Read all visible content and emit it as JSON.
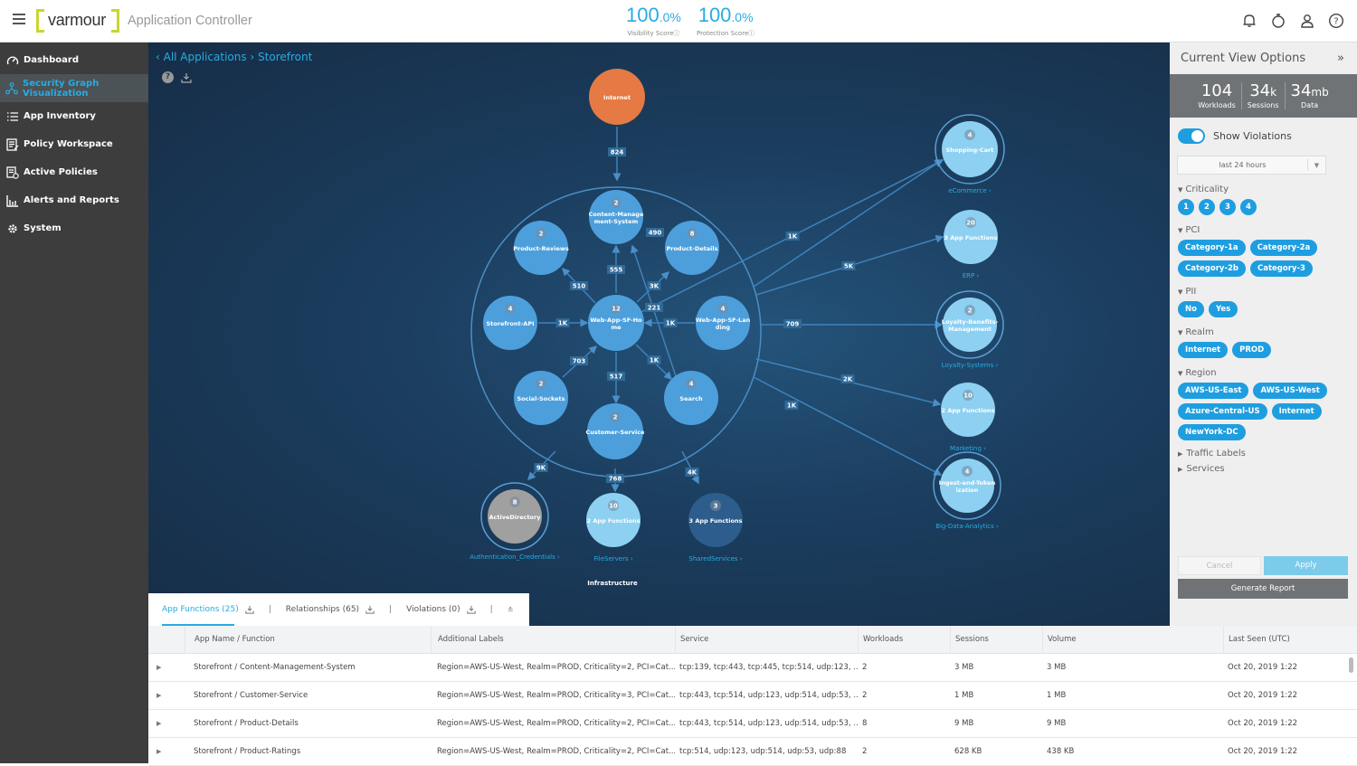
{
  "header": {
    "brand": "varmour",
    "app_title": "Application Controller",
    "visibility_score": {
      "value": "100",
      "decimal": ".0%",
      "label": "Visibility Scoreⓘ"
    },
    "protection_score": {
      "value": "100",
      "decimal": ".0%",
      "label": "Protection Scoreⓘ"
    },
    "icons": [
      "bell-icon",
      "timer-icon",
      "user-icon",
      "help-icon"
    ]
  },
  "sidebar": {
    "items": [
      {
        "label": "Dashboard",
        "icon": "gauge-icon",
        "active": false
      },
      {
        "label": "Security Graph Visualization",
        "icon": "graph-icon",
        "active": true
      },
      {
        "label": "App Inventory",
        "icon": "list-icon",
        "active": false
      },
      {
        "label": "Policy Workspace",
        "icon": "policy-edit-icon",
        "active": false
      },
      {
        "label": "Active Policies",
        "icon": "policy-check-icon",
        "active": false
      },
      {
        "label": "Alerts and Reports",
        "icon": "bar-chart-icon",
        "active": false
      },
      {
        "label": "System",
        "icon": "gear-icon",
        "active": false
      }
    ]
  },
  "graph": {
    "breadcrumb": "‹ All Applications › Storefront",
    "container_label": "Infrastructure",
    "nodes": [
      {
        "id": "internet",
        "label": [
          "Internet"
        ],
        "count": null,
        "color": "#e57a44"
      },
      {
        "id": "cms",
        "label": [
          "Content-Manage",
          "ment-System"
        ],
        "count": "2",
        "color": "#4d9fdc"
      },
      {
        "id": "reviews",
        "label": [
          "Product-Reviews"
        ],
        "count": "2",
        "color": "#4d9fdc"
      },
      {
        "id": "details",
        "label": [
          "Product-Details"
        ],
        "count": "8",
        "color": "#4d9fdc"
      },
      {
        "id": "api",
        "label": [
          "Storefront-API"
        ],
        "count": "4",
        "color": "#4d9fdc"
      },
      {
        "id": "home",
        "label": [
          "Web-App-SF-Ho",
          "me"
        ],
        "count": "12",
        "color": "#4d9fdc"
      },
      {
        "id": "landing",
        "label": [
          "Web-App-SF-Lan",
          "ding"
        ],
        "count": "4",
        "color": "#4d9fdc"
      },
      {
        "id": "social",
        "label": [
          "Social-Sockets"
        ],
        "count": "2",
        "color": "#4d9fdc"
      },
      {
        "id": "search",
        "label": [
          "Search"
        ],
        "count": "4",
        "color": "#4d9fdc"
      },
      {
        "id": "customer",
        "label": [
          "Customer-Service"
        ],
        "count": "2",
        "color": "#4d9fdc"
      },
      {
        "id": "ad",
        "label": [
          "ActiveDirectory"
        ],
        "count": "8",
        "color": "#a0a0a0",
        "group": "Authentication_Credentials ›"
      },
      {
        "id": "fileservers",
        "label": [
          "2 App Functions"
        ],
        "count": "10",
        "color": "#8dd0f2",
        "group": "FileServers ›"
      },
      {
        "id": "shared",
        "label": [
          "3 App Functions"
        ],
        "count": "3",
        "color": "#2c5d8c",
        "group": "SharedServices ›"
      },
      {
        "id": "cart",
        "label": [
          "Shopping-Cart"
        ],
        "count": "4",
        "color": "#8dd0f2",
        "group": "eCommerce ›"
      },
      {
        "id": "erp",
        "label": [
          "3 App Functions"
        ],
        "count": "20",
        "color": "#8dd0f2",
        "group": "ERP ›"
      },
      {
        "id": "loyalty",
        "label": [
          "Loyalty-Benefits-",
          "Management"
        ],
        "count": "2",
        "color": "#8dd0f2",
        "group": "Loyalty-Systems ›"
      },
      {
        "id": "marketing",
        "label": [
          "2 App Functions"
        ],
        "count": "10",
        "color": "#8dd0f2",
        "group": "Marketing ›"
      },
      {
        "id": "ingest",
        "label": [
          "Ingest-and-Token",
          "ization"
        ],
        "count": "4",
        "color": "#8dd0f2",
        "group": "Big-Data-Analytics ›"
      }
    ],
    "edges": [
      {
        "from": "internet",
        "to": "container",
        "label": "824"
      },
      {
        "from": "home",
        "to": "cms",
        "label": "555"
      },
      {
        "from": "home",
        "to": "reviews",
        "label": "510"
      },
      {
        "from": "home",
        "to": "details",
        "label": "3K"
      },
      {
        "from": "search",
        "to": "cms",
        "label": "490"
      },
      {
        "from": "api",
        "to": "home",
        "label": "1K"
      },
      {
        "from": "landing",
        "to": "home",
        "label": "1K"
      },
      {
        "from": "home",
        "to": "cart",
        "label": "221"
      },
      {
        "from": "social",
        "to": "home",
        "label": "703"
      },
      {
        "from": "home",
        "to": "customer",
        "label": "517"
      },
      {
        "from": "home",
        "to": "search",
        "label": "1K"
      },
      {
        "from": "container",
        "to": "ad",
        "label": "9K"
      },
      {
        "from": "container",
        "to": "fileservers",
        "label": "768"
      },
      {
        "from": "container",
        "to": "shared",
        "label": "4K"
      },
      {
        "from": "container",
        "to": "cart",
        "label": "1K"
      },
      {
        "from": "container",
        "to": "erp",
        "label": "5K"
      },
      {
        "from": "container",
        "to": "loyalty",
        "label": "709"
      },
      {
        "from": "container",
        "to": "marketing",
        "label": "2K"
      },
      {
        "from": "container",
        "to": "ingest",
        "label": "1K"
      }
    ]
  },
  "tabs": [
    {
      "label": "App Functions (25)",
      "active": true
    },
    {
      "label": "Relationships (65)",
      "active": false
    },
    {
      "label": "Violations (0)",
      "active": false
    }
  ],
  "panel": {
    "title": "Current View Options",
    "collapse_icon": "»",
    "stats": [
      {
        "value": "104",
        "unit": "",
        "label": "Workloads"
      },
      {
        "value": "34",
        "unit": "k",
        "label": "Sessions"
      },
      {
        "value": "34",
        "unit": "mb",
        "label": "Data"
      }
    ],
    "show_violations": {
      "label": "Show Violations",
      "on": true
    },
    "time_range": "last 24 hours",
    "filters": [
      {
        "title": "Criticality",
        "chips": [
          "1",
          "2",
          "3",
          "4"
        ],
        "round": true
      },
      {
        "title": "PCI",
        "chips": [
          "Category-1a",
          "Category-2a",
          "Category-2b",
          "Category-3"
        ]
      },
      {
        "title": "PII",
        "chips": [
          "No",
          "Yes"
        ]
      },
      {
        "title": "Realm",
        "chips": [
          "Internet",
          "PROD"
        ]
      },
      {
        "title": "Region",
        "chips": [
          "AWS-US-East",
          "AWS-US-West",
          "Azure-Central-US",
          "Internet",
          "NewYork-DC"
        ]
      }
    ],
    "collapsed_sections": [
      "Traffic Labels",
      "Services"
    ],
    "cancel_label": "Cancel",
    "apply_label": "Apply",
    "report_label": "Generate Report"
  },
  "table": {
    "columns": [
      "App Name / Function",
      "Additional Labels",
      "Service",
      "Workloads",
      "Sessions",
      "Volume",
      "Last Seen (UTC)"
    ],
    "rows": [
      [
        "Storefront / Content-Management-System",
        "Region=AWS-US-West, Realm=PROD, Criticality=2, PCI=Cat...",
        "tcp:139, tcp:443, tcp:445, tcp:514, udp:123, ...",
        "2",
        "3 MB",
        "3 MB",
        "Oct 20, 2019 1:22"
      ],
      [
        "Storefront / Customer-Service",
        "Region=AWS-US-West, Realm=PROD, Criticality=3, PCI=Cat...",
        "tcp:443, tcp:514, udp:123, udp:514, udp:53, ...",
        "2",
        "1 MB",
        "1 MB",
        "Oct 20, 2019 1:22"
      ],
      [
        "Storefront / Product-Details",
        "Region=AWS-US-West, Realm=PROD, Criticality=2, PCI=Cat...",
        "tcp:443, tcp:514, udp:123, udp:514, udp:53, ...",
        "8",
        "9 MB",
        "9 MB",
        "Oct 20, 2019 1:22"
      ],
      [
        "Storefront / Product-Ratings",
        "Region=AWS-US-West, Realm=PROD, Criticality=2, PCI=Cat...",
        "tcp:514, udp:123, udp:514, udp:53, udp:88",
        "2",
        "628 KB",
        "438 KB",
        "Oct 20, 2019 1:22"
      ]
    ]
  }
}
